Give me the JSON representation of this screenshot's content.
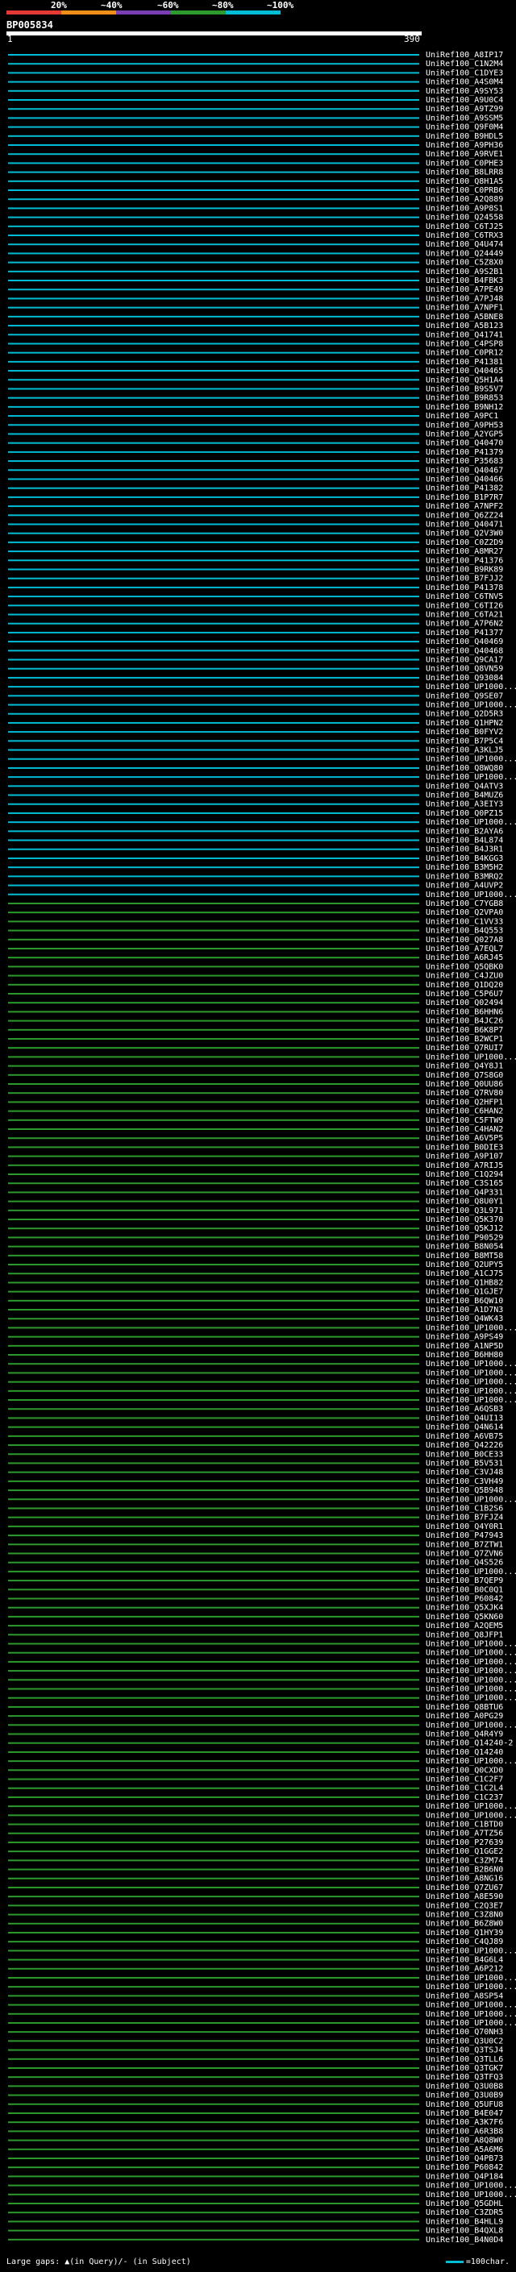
{
  "legend": {
    "labels": [
      "20%",
      "~40%",
      "~60%",
      "~80%",
      "~100%"
    ],
    "colors": [
      "#e53935",
      "#ef8f1a",
      "#7b3fb5",
      "#2c9a2c",
      "#00bcd4"
    ]
  },
  "query": {
    "id": "BP005834",
    "start": "1",
    "end": "390"
  },
  "footer": {
    "left": "Large gaps: ▲(in Query)/- (in Subject)",
    "right": "=100char."
  },
  "chart_data": {
    "type": "alignment-overview",
    "query_length": 390,
    "hits": [
      {
        "id": "UniRef100_A8IP17",
        "color": "cyan"
      },
      {
        "id": "UniRef100_C1N2M4",
        "color": "cyan"
      },
      {
        "id": "UniRef100_C1DYE3",
        "color": "cyan"
      },
      {
        "id": "UniRef100_A4S0M4",
        "color": "cyan"
      },
      {
        "id": "UniRef100_A9SY53",
        "color": "cyan"
      },
      {
        "id": "UniRef100_A9U0C4",
        "color": "cyan"
      },
      {
        "id": "UniRef100_A9TZ99",
        "color": "cyan"
      },
      {
        "id": "UniRef100_A9SSM5",
        "color": "cyan"
      },
      {
        "id": "UniRef100_Q9F0M4",
        "color": "cyan"
      },
      {
        "id": "UniRef100_B9HDL5",
        "color": "cyan"
      },
      {
        "id": "UniRef100_A9PH36",
        "color": "cyan"
      },
      {
        "id": "UniRef100_A9RVE1",
        "color": "cyan"
      },
      {
        "id": "UniRef100_C0PHE3",
        "color": "cyan"
      },
      {
        "id": "UniRef100_B8LRR8",
        "color": "cyan"
      },
      {
        "id": "UniRef100_Q8H1A5",
        "color": "cyan"
      },
      {
        "id": "UniRef100_C0PRB6",
        "color": "cyan"
      },
      {
        "id": "UniRef100_A2Q889",
        "color": "cyan"
      },
      {
        "id": "UniRef100_A9P8S1",
        "color": "cyan"
      },
      {
        "id": "UniRef100_Q24558",
        "color": "cyan"
      },
      {
        "id": "UniRef100_C6TJ25",
        "color": "cyan"
      },
      {
        "id": "UniRef100_C6TRX3",
        "color": "cyan"
      },
      {
        "id": "UniRef100_Q4U474",
        "color": "cyan"
      },
      {
        "id": "UniRef100_Q24449",
        "color": "cyan"
      },
      {
        "id": "UniRef100_C5Z8X0",
        "color": "cyan"
      },
      {
        "id": "UniRef100_A9S2B1",
        "color": "cyan"
      },
      {
        "id": "UniRef100_B4FBK3",
        "color": "cyan"
      },
      {
        "id": "UniRef100_A7PE49",
        "color": "cyan"
      },
      {
        "id": "UniRef100_A7PJ48",
        "color": "cyan"
      },
      {
        "id": "UniRef100_A7NPF1",
        "color": "cyan"
      },
      {
        "id": "UniRef100_A5BNE8",
        "color": "cyan"
      },
      {
        "id": "UniRef100_A5B123",
        "color": "cyan"
      },
      {
        "id": "UniRef100_Q41741",
        "color": "cyan"
      },
      {
        "id": "UniRef100_C4PSP8",
        "color": "cyan"
      },
      {
        "id": "UniRef100_C0PR12",
        "color": "cyan"
      },
      {
        "id": "UniRef100_P41381",
        "color": "cyan"
      },
      {
        "id": "UniRef100_Q40465",
        "color": "cyan"
      },
      {
        "id": "UniRef100_Q5H1A4",
        "color": "cyan"
      },
      {
        "id": "UniRef100_B9S5V7",
        "color": "cyan"
      },
      {
        "id": "UniRef100_B9R853",
        "color": "cyan"
      },
      {
        "id": "UniRef100_B9NH12",
        "color": "cyan"
      },
      {
        "id": "UniRef100_A9PC1",
        "color": "cyan"
      },
      {
        "id": "UniRef100_A9PH53",
        "color": "cyan"
      },
      {
        "id": "UniRef100_A2YGP5",
        "color": "cyan"
      },
      {
        "id": "UniRef100_Q40470",
        "color": "cyan"
      },
      {
        "id": "UniRef100_P41379",
        "color": "cyan"
      },
      {
        "id": "UniRef100_P35683",
        "color": "cyan"
      },
      {
        "id": "UniRef100_Q40467",
        "color": "cyan"
      },
      {
        "id": "UniRef100_Q40466",
        "color": "cyan"
      },
      {
        "id": "UniRef100_P41382",
        "color": "cyan"
      },
      {
        "id": "UniRef100_B1P7R7",
        "color": "cyan"
      },
      {
        "id": "UniRef100_A7NPF2",
        "color": "cyan"
      },
      {
        "id": "UniRef100_Q6ZZ24",
        "color": "cyan"
      },
      {
        "id": "UniRef100_Q40471",
        "color": "cyan"
      },
      {
        "id": "UniRef100_Q2V3W0",
        "color": "cyan"
      },
      {
        "id": "UniRef100_C0Z2D9",
        "color": "cyan"
      },
      {
        "id": "UniRef100_A8MR27",
        "color": "cyan"
      },
      {
        "id": "UniRef100_P41376",
        "color": "cyan"
      },
      {
        "id": "UniRef100_B9RK89",
        "color": "cyan"
      },
      {
        "id": "UniRef100_B7FJJ2",
        "color": "cyan"
      },
      {
        "id": "UniRef100_P41378",
        "color": "cyan"
      },
      {
        "id": "UniRef100_C6TNV5",
        "color": "cyan"
      },
      {
        "id": "UniRef100_C6TI26",
        "color": "cyan"
      },
      {
        "id": "UniRef100_C6TA21",
        "color": "cyan"
      },
      {
        "id": "UniRef100_A7P6N2",
        "color": "cyan"
      },
      {
        "id": "UniRef100_P41377",
        "color": "cyan"
      },
      {
        "id": "UniRef100_Q40469",
        "color": "cyan"
      },
      {
        "id": "UniRef100_Q40468",
        "color": "cyan"
      },
      {
        "id": "UniRef100_Q9CA17",
        "color": "cyan"
      },
      {
        "id": "UniRef100_Q8VN59",
        "color": "cyan"
      },
      {
        "id": "UniRef100_Q93084",
        "color": "cyan"
      },
      {
        "id": "UniRef100_UP1000...",
        "color": "cyan"
      },
      {
        "id": "UniRef100_Q9SE07",
        "color": "cyan"
      },
      {
        "id": "UniRef100_UP1000...",
        "color": "cyan"
      },
      {
        "id": "UniRef100_Q2D5R3",
        "color": "cyan"
      },
      {
        "id": "UniRef100_Q1HPN2",
        "color": "cyan"
      },
      {
        "id": "UniRef100_B0FYV2",
        "color": "cyan"
      },
      {
        "id": "UniRef100_B7P5C4",
        "color": "cyan"
      },
      {
        "id": "UniRef100_A3KLJ5",
        "color": "cyan"
      },
      {
        "id": "UniRef100_UP1000...",
        "color": "cyan"
      },
      {
        "id": "UniRef100_Q8WQ80",
        "color": "cyan"
      },
      {
        "id": "UniRef100_UP1000...",
        "color": "cyan"
      },
      {
        "id": "UniRef100_Q4ATV3",
        "color": "cyan"
      },
      {
        "id": "UniRef100_B4MUZ6",
        "color": "cyan"
      },
      {
        "id": "UniRef100_A3EIY3",
        "color": "cyan"
      },
      {
        "id": "UniRef100_Q0PZ15",
        "color": "cyan"
      },
      {
        "id": "UniRef100_UP1000...",
        "color": "cyan"
      },
      {
        "id": "UniRef100_B2AYA6",
        "color": "cyan"
      },
      {
        "id": "UniRef100_B4L874",
        "color": "cyan"
      },
      {
        "id": "UniRef100_B4J3R1",
        "color": "cyan"
      },
      {
        "id": "UniRef100_B4KGG3",
        "color": "cyan"
      },
      {
        "id": "UniRef100_B3M5H2",
        "color": "cyan"
      },
      {
        "id": "UniRef100_B3MRQ2",
        "color": "cyan"
      },
      {
        "id": "UniRef100_A4UVP2",
        "color": "cyan"
      },
      {
        "id": "UniRef100_UP1000...",
        "color": "cyan"
      },
      {
        "id": "UniRef100_C7YGB8",
        "color": "green"
      },
      {
        "id": "UniRef100_Q2VPA0",
        "color": "green"
      },
      {
        "id": "UniRef100_C1VV33",
        "color": "green"
      },
      {
        "id": "UniRef100_B4Q553",
        "color": "green"
      },
      {
        "id": "UniRef100_Q027A8",
        "color": "green"
      },
      {
        "id": "UniRef100_A7EQL7",
        "color": "green"
      },
      {
        "id": "UniRef100_A6RJ45",
        "color": "green"
      },
      {
        "id": "UniRef100_Q5QBK0",
        "color": "green"
      },
      {
        "id": "UniRef100_C4JZU0",
        "color": "green"
      },
      {
        "id": "UniRef100_Q1DQ20",
        "color": "green"
      },
      {
        "id": "UniRef100_C5P6U7",
        "color": "green"
      },
      {
        "id": "UniRef100_Q02494",
        "color": "green"
      },
      {
        "id": "UniRef100_B6HHN6",
        "color": "green"
      },
      {
        "id": "UniRef100_B4JC26",
        "color": "green"
      },
      {
        "id": "UniRef100_B6K8P7",
        "color": "green"
      },
      {
        "id": "UniRef100_B2WCP1",
        "color": "green"
      },
      {
        "id": "UniRef100_Q7RUI7",
        "color": "green"
      },
      {
        "id": "UniRef100_UP1000...",
        "color": "green"
      },
      {
        "id": "UniRef100_Q4Y8J1",
        "color": "green"
      },
      {
        "id": "UniRef100_Q7S8G0",
        "color": "green"
      },
      {
        "id": "UniRef100_Q0UU86",
        "color": "green"
      },
      {
        "id": "UniRef100_Q7RV80",
        "color": "green"
      },
      {
        "id": "UniRef100_Q2HFP1",
        "color": "green"
      },
      {
        "id": "UniRef100_C6HAN2",
        "color": "green"
      },
      {
        "id": "UniRef100_C5FTW9",
        "color": "green"
      },
      {
        "id": "UniRef100_C4HAN2",
        "color": "green"
      },
      {
        "id": "UniRef100_A6V5P5",
        "color": "green"
      },
      {
        "id": "UniRef100_B0DIE3",
        "color": "green"
      },
      {
        "id": "UniRef100_A9P107",
        "color": "green"
      },
      {
        "id": "UniRef100_A7RIJ5",
        "color": "green"
      },
      {
        "id": "UniRef100_C1Q294",
        "color": "green"
      },
      {
        "id": "UniRef100_C3S165",
        "color": "green"
      },
      {
        "id": "UniRef100_Q4P331",
        "color": "green"
      },
      {
        "id": "UniRef100_Q8U0Y1",
        "color": "green"
      },
      {
        "id": "UniRef100_Q3L971",
        "color": "green"
      },
      {
        "id": "UniRef100_Q5K370",
        "color": "green"
      },
      {
        "id": "UniRef100_Q5KJ12",
        "color": "green"
      },
      {
        "id": "UniRef100_P90529",
        "color": "green"
      },
      {
        "id": "UniRef100_B8N054",
        "color": "green"
      },
      {
        "id": "UniRef100_B8MT58",
        "color": "green"
      },
      {
        "id": "UniRef100_Q2UPY5",
        "color": "green"
      },
      {
        "id": "UniRef100_A1CJ75",
        "color": "green"
      },
      {
        "id": "UniRef100_Q1HB82",
        "color": "green"
      },
      {
        "id": "UniRef100_Q1GJE7",
        "color": "green"
      },
      {
        "id": "UniRef100_B6QW10",
        "color": "green"
      },
      {
        "id": "UniRef100_A1D7N3",
        "color": "green"
      },
      {
        "id": "UniRef100_Q4WK43",
        "color": "green"
      },
      {
        "id": "UniRef100_UP1000...",
        "color": "green"
      },
      {
        "id": "UniRef100_A9PS49",
        "color": "green"
      },
      {
        "id": "UniRef100_A1NP5D",
        "color": "green"
      },
      {
        "id": "UniRef100_B6HH80",
        "color": "green"
      },
      {
        "id": "UniRef100_UP1000...",
        "color": "green"
      },
      {
        "id": "UniRef100_UP1000...",
        "color": "green"
      },
      {
        "id": "UniRef100_UP1000...",
        "color": "green"
      },
      {
        "id": "UniRef100_UP1000...",
        "color": "green"
      },
      {
        "id": "UniRef100_UP1000...",
        "color": "green"
      },
      {
        "id": "UniRef100_A6QSB3",
        "color": "green"
      },
      {
        "id": "UniRef100_Q4UI13",
        "color": "green"
      },
      {
        "id": "UniRef100_Q4N614",
        "color": "green"
      },
      {
        "id": "UniRef100_A6VB75",
        "color": "green"
      },
      {
        "id": "UniRef100_Q42226",
        "color": "green"
      },
      {
        "id": "UniRef100_B0CE33",
        "color": "green"
      },
      {
        "id": "UniRef100_B5V531",
        "color": "green"
      },
      {
        "id": "UniRef100_C3VJ48",
        "color": "green"
      },
      {
        "id": "UniRef100_C3VH49",
        "color": "green"
      },
      {
        "id": "UniRef100_Q5B948",
        "color": "green"
      },
      {
        "id": "UniRef100_UP1000...",
        "color": "green"
      },
      {
        "id": "UniRef100_C1B2S6",
        "color": "green"
      },
      {
        "id": "UniRef100_B7FJZ4",
        "color": "green"
      },
      {
        "id": "UniRef100_Q4Y0R1",
        "color": "green"
      },
      {
        "id": "UniRef100_P47943",
        "color": "green"
      },
      {
        "id": "UniRef100_B7ZTW1",
        "color": "green"
      },
      {
        "id": "UniRef100_Q7ZVN6",
        "color": "green"
      },
      {
        "id": "UniRef100_Q4S526",
        "color": "green"
      },
      {
        "id": "UniRef100_UP1000...",
        "color": "green"
      },
      {
        "id": "UniRef100_B7QEP9",
        "color": "green"
      },
      {
        "id": "UniRef100_B0C0Q1",
        "color": "green"
      },
      {
        "id": "UniRef100_P60842",
        "color": "green"
      },
      {
        "id": "UniRef100_Q5XJK4",
        "color": "green"
      },
      {
        "id": "UniRef100_Q5KN60",
        "color": "green"
      },
      {
        "id": "UniRef100_A2QEM5",
        "color": "green"
      },
      {
        "id": "UniRef100_Q8JFP1",
        "color": "green"
      },
      {
        "id": "UniRef100_UP1000...",
        "color": "green"
      },
      {
        "id": "UniRef100_UP1000...",
        "color": "green"
      },
      {
        "id": "UniRef100_UP1000...",
        "color": "green"
      },
      {
        "id": "UniRef100_UP1000...",
        "color": "green"
      },
      {
        "id": "UniRef100_UP1000...",
        "color": "green"
      },
      {
        "id": "UniRef100_UP1000...",
        "color": "green"
      },
      {
        "id": "UniRef100_UP1000...",
        "color": "green"
      },
      {
        "id": "UniRef100_Q8BTU6",
        "color": "green"
      },
      {
        "id": "UniRef100_A0PG29",
        "color": "green"
      },
      {
        "id": "UniRef100_UP1000...",
        "color": "green"
      },
      {
        "id": "UniRef100_Q4R4Y9",
        "color": "green"
      },
      {
        "id": "UniRef100_Q14240-2",
        "color": "green"
      },
      {
        "id": "UniRef100_Q14240",
        "color": "green"
      },
      {
        "id": "UniRef100_UP1000...",
        "color": "green"
      },
      {
        "id": "UniRef100_Q0CXD0",
        "color": "green"
      },
      {
        "id": "UniRef100_C1C2F7",
        "color": "green"
      },
      {
        "id": "UniRef100_C1C2L4",
        "color": "green"
      },
      {
        "id": "UniRef100_C1C237",
        "color": "green"
      },
      {
        "id": "UniRef100_UP1000...",
        "color": "green"
      },
      {
        "id": "UniRef100_UP1000...",
        "color": "green"
      },
      {
        "id": "UniRef100_C1BTD0",
        "color": "green"
      },
      {
        "id": "UniRef100_A7TZ56",
        "color": "green"
      },
      {
        "id": "UniRef100_P27639",
        "color": "green"
      },
      {
        "id": "UniRef100_Q1GGE2",
        "color": "green"
      },
      {
        "id": "UniRef100_C3ZM74",
        "color": "green"
      },
      {
        "id": "UniRef100_B2B6N0",
        "color": "green"
      },
      {
        "id": "UniRef100_A8NG16",
        "color": "green"
      },
      {
        "id": "UniRef100_Q7ZU67",
        "color": "green"
      },
      {
        "id": "UniRef100_A8E590",
        "color": "green"
      },
      {
        "id": "UniRef100_C2Q3E7",
        "color": "green"
      },
      {
        "id": "UniRef100_C3Z8N0",
        "color": "green"
      },
      {
        "id": "UniRef100_B6Z8W0",
        "color": "green"
      },
      {
        "id": "UniRef100_Q1HY39",
        "color": "green"
      },
      {
        "id": "UniRef100_C4QJ89",
        "color": "green"
      },
      {
        "id": "UniRef100_UP1000...",
        "color": "green"
      },
      {
        "id": "UniRef100_B4G6L4",
        "color": "green"
      },
      {
        "id": "UniRef100_A6P212",
        "color": "green"
      },
      {
        "id": "UniRef100_UP1000...",
        "color": "green"
      },
      {
        "id": "UniRef100_UP1000...",
        "color": "green"
      },
      {
        "id": "UniRef100_A8SP54",
        "color": "green"
      },
      {
        "id": "UniRef100_UP1000...",
        "color": "green"
      },
      {
        "id": "UniRef100_UP1000...",
        "color": "green"
      },
      {
        "id": "UniRef100_UP1000...",
        "color": "green"
      },
      {
        "id": "UniRef100_Q70NH3",
        "color": "green"
      },
      {
        "id": "UniRef100_Q3U0C2",
        "color": "green"
      },
      {
        "id": "UniRef100_Q3TSJ4",
        "color": "green"
      },
      {
        "id": "UniRef100_Q3TLL6",
        "color": "green"
      },
      {
        "id": "UniRef100_Q3TGK7",
        "color": "green"
      },
      {
        "id": "UniRef100_Q3TFQ3",
        "color": "green"
      },
      {
        "id": "UniRef100_Q3U0B8",
        "color": "green"
      },
      {
        "id": "UniRef100_Q3U0B9",
        "color": "green"
      },
      {
        "id": "UniRef100_Q5UFU8",
        "color": "green"
      },
      {
        "id": "UniRef100_B4E047",
        "color": "green"
      },
      {
        "id": "UniRef100_A3K7F6",
        "color": "green"
      },
      {
        "id": "UniRef100_A6R3B8",
        "color": "green"
      },
      {
        "id": "UniRef100_A8Q8W0",
        "color": "green"
      },
      {
        "id": "UniRef100_A5A6M6",
        "color": "green"
      },
      {
        "id": "UniRef100_Q4PB73",
        "color": "green"
      },
      {
        "id": "UniRef100_P60842",
        "color": "green"
      },
      {
        "id": "UniRef100_Q4P184",
        "color": "green"
      },
      {
        "id": "UniRef100_UP1000...",
        "color": "green"
      },
      {
        "id": "UniRef100_UP1000...",
        "color": "green"
      },
      {
        "id": "UniRef100_Q5GDHL",
        "color": "green"
      },
      {
        "id": "UniRef100_C3ZDR5",
        "color": "green"
      },
      {
        "id": "UniRef100_B4HLL9",
        "color": "green"
      },
      {
        "id": "UniRef100_B4QXL8",
        "color": "green"
      },
      {
        "id": "UniRef100_B4N0D4",
        "color": "green"
      }
    ]
  }
}
